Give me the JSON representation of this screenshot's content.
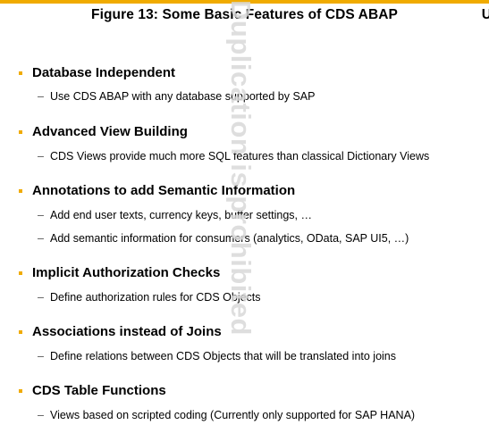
{
  "figure": {
    "title": "Figure 13: Some Basic Features of CDS ABAP",
    "edge_letter": "U"
  },
  "watermark": {
    "text": "Duplication is prohibited"
  },
  "colors": {
    "accent": "#f0ab00",
    "text": "#000000",
    "watermark": "#d9d9d9"
  },
  "sections": [
    {
      "heading": "Database Independent",
      "items": [
        "Use CDS ABAP with any database supported by SAP"
      ]
    },
    {
      "heading": "Advanced View Building",
      "items": [
        "CDS Views provide much more SQL features than classical Dictionary Views"
      ]
    },
    {
      "heading": "Annotations to add Semantic Information",
      "items": [
        "Add end user texts, currency keys, buffer settings, …",
        "Add semantic information for consumers (analytics, OData, SAP UI5, …)"
      ]
    },
    {
      "heading": "Implicit Authorization Checks",
      "items": [
        "Define authorization rules for CDS Objects"
      ]
    },
    {
      "heading": "Associations instead of Joins",
      "items": [
        "Define relations between CDS Objects that will be translated into joins"
      ]
    },
    {
      "heading": "CDS Table Functions",
      "items": [
        "Views based on scripted coding (Currently only supported for SAP HANA)"
      ]
    }
  ]
}
